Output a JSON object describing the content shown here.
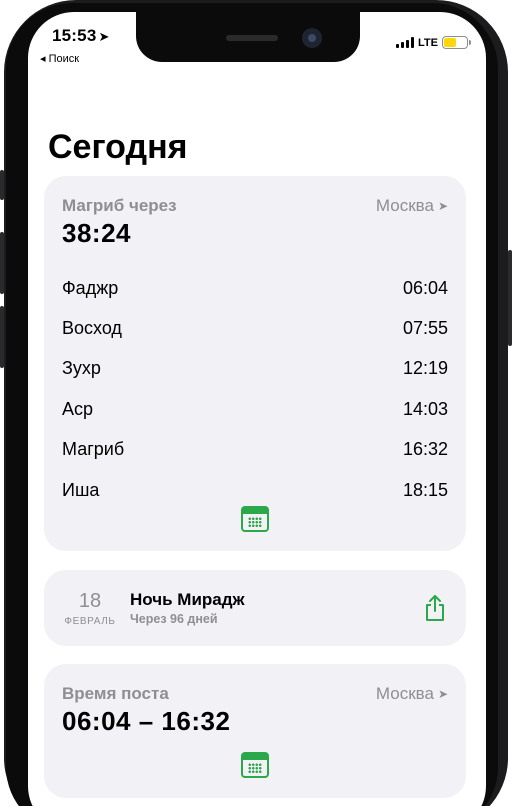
{
  "status_bar": {
    "time": "15:53",
    "back_label": "◂ Поиск",
    "network": "LTE",
    "battery_level": 0.55,
    "battery_color": "#ffd60a"
  },
  "page": {
    "title": "Сегодня"
  },
  "prayer_card": {
    "label": "Магриб через",
    "city": "Москва",
    "countdown": "38:24",
    "prayers": [
      {
        "name": "Фаджр",
        "time": "06:04"
      },
      {
        "name": "Восход",
        "time": "07:55"
      },
      {
        "name": "Зухр",
        "time": "12:19"
      },
      {
        "name": "Аср",
        "time": "14:03"
      },
      {
        "name": "Магриб",
        "time": "16:32"
      },
      {
        "name": "Иша",
        "time": "18:15"
      }
    ],
    "icon": "calendar-icon"
  },
  "event_card": {
    "day": "18",
    "month": "ФЕВРАЛЬ",
    "title": "Ночь Мирадж",
    "subtitle": "Через 96 дней",
    "icon": "share-icon"
  },
  "fast_card": {
    "label": "Время поста",
    "city": "Москва",
    "range": "06:04 – 16:32",
    "icon": "calendar-icon"
  },
  "colors": {
    "accent": "#2aa84a",
    "card_bg": "#f1f1f6",
    "secondary_text": "#8e8e93"
  }
}
